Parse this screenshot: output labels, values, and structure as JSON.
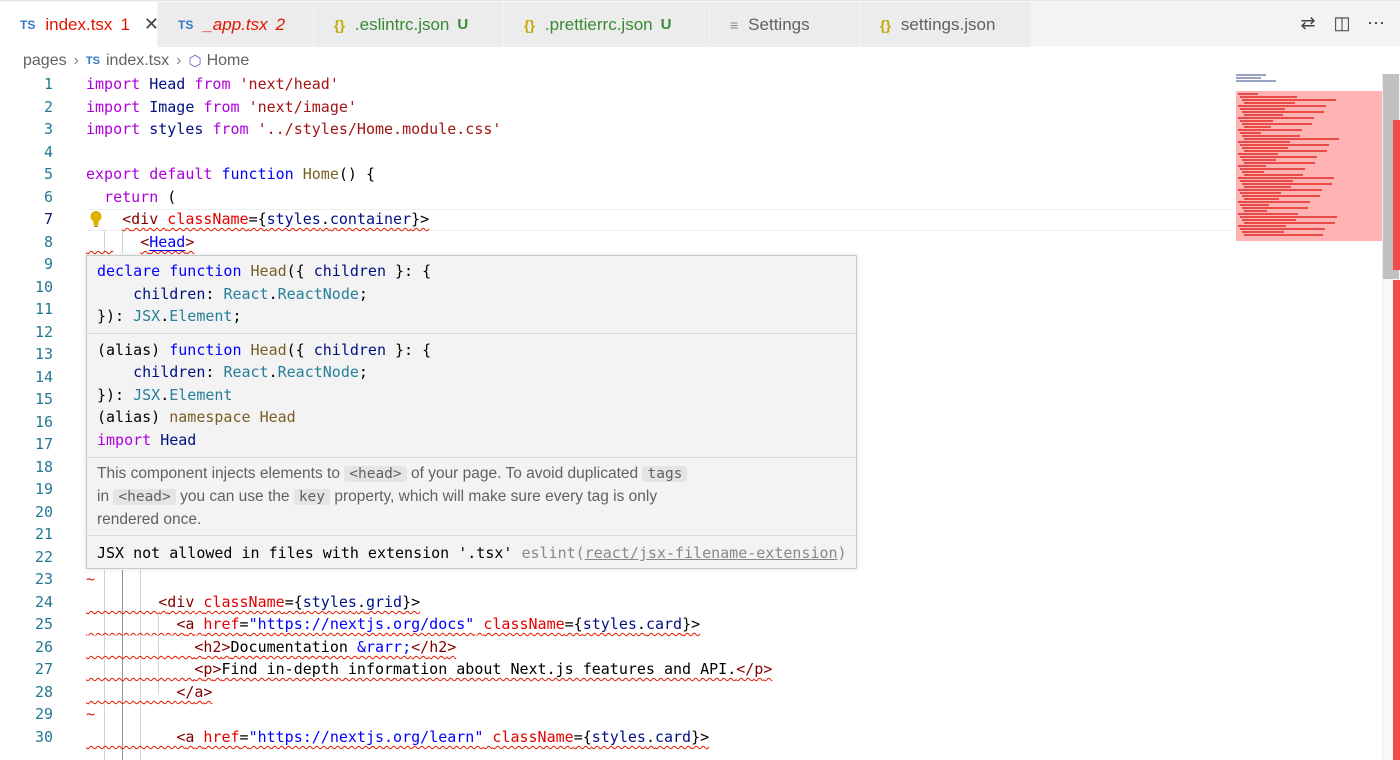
{
  "tabs": [
    {
      "type": "ts",
      "label": "index.tsx",
      "count": "1",
      "active": true,
      "closable": true
    },
    {
      "type": "ts",
      "label": "_app.tsx",
      "count": "2",
      "active": false
    },
    {
      "type": "json",
      "label": ".eslintrc.json",
      "badge": "U",
      "active": false
    },
    {
      "type": "json",
      "label": ".prettierrc.json",
      "badge": "U",
      "active": false
    },
    {
      "type": "settings",
      "label": "Settings",
      "active": false
    },
    {
      "type": "json",
      "label": "settings.json",
      "active": false
    }
  ],
  "tab_icon_ts": "TS",
  "tab_icon_json": "{}",
  "breadcrumb": {
    "folder": "pages",
    "file": "index.tsx",
    "symbol": "Home"
  },
  "line_numbers": [
    "1",
    "2",
    "3",
    "4",
    "5",
    "6",
    "7",
    "8",
    "9",
    "10",
    "11",
    "12",
    "13",
    "14",
    "15",
    "16",
    "17",
    "18",
    "19",
    "20",
    "21",
    "22",
    "23",
    "24",
    "25",
    "26",
    "27",
    "28",
    "29",
    "30"
  ],
  "code": {
    "l1": {
      "kw": "import",
      "id": "Head",
      "from": "from",
      "str": "'next/head'"
    },
    "l2": {
      "kw": "import",
      "id": "Image",
      "from": "from",
      "str": "'next/image'"
    },
    "l3": {
      "kw": "import",
      "id": "styles",
      "from": "from",
      "str": "'../styles/Home.module.css'"
    },
    "l5": {
      "export": "export",
      "default": "default",
      "function": "function",
      "name": "Home",
      "rest": "() {"
    },
    "l6": {
      "ret": "return",
      "rest": " ("
    },
    "l7": {
      "open": "<",
      "tag": "div",
      "attr": "className",
      "eq": "={",
      "obj": "styles",
      "prop": "container",
      "close": "}>"
    },
    "l8": {
      "open": "<",
      "tag": "Head",
      "close": ">"
    },
    "l24": {
      "open": "<",
      "tag": "div",
      "attr": "className",
      "eq": "={",
      "obj": "styles",
      "prop": "grid",
      "close": "}>"
    },
    "l25": {
      "open": "<",
      "tag": "a",
      "attr": "href",
      "eq": "=",
      "str": "\"https://nextjs.org/docs\"",
      "attr2": "className",
      "eq2": "={",
      "obj": "styles",
      "prop": "card",
      "close": "}>"
    },
    "l26": {
      "open": "<",
      "tag": "h2",
      "gt": ">",
      "text": "Documentation ",
      "ent": "&rarr;",
      "end": "</",
      "endtag": "h2",
      "endgt": ">"
    },
    "l27": {
      "open": "<",
      "tag": "p",
      "gt": ">",
      "text": "Find in-depth information about Next.js features and API.",
      "end": "</",
      "endtag": "p",
      "endgt": ">"
    },
    "l28": {
      "end": "</",
      "endtag": "a",
      "endgt": ">"
    },
    "l30": {
      "open": "<",
      "tag": "a",
      "attr": "href",
      "eq": "=",
      "str": "\"https://nextjs.org/learn\"",
      "attr2": "className",
      "eq2": "={",
      "obj": "styles",
      "prop": "card",
      "close": "}>"
    }
  },
  "hover": {
    "decl": {
      "line1": {
        "declare": "declare",
        "function": "function",
        "name": "Head",
        "rest1": "({ ",
        "param": "children",
        "rest2": " }: {"
      },
      "line2": {
        "indent": "    ",
        "param": "children",
        "colon": ": ",
        "ns": "React",
        "dot": ".",
        "type": "ReactNode",
        "semi": ";"
      },
      "line3": {
        "close": "}): ",
        "ns": "JSX",
        "dot": ".",
        "type": "Element",
        "semi": ";"
      }
    },
    "alias": {
      "line1": {
        "alias": "(alias) ",
        "function": "function",
        "name": "Head",
        "rest1": "({ ",
        "param": "children",
        "rest2": " }: {"
      },
      "line2": {
        "indent": "    ",
        "param": "children",
        "colon": ": ",
        "ns": "React",
        "dot": ".",
        "type": "ReactNode",
        "semi": ";"
      },
      "line3": {
        "close": "}): ",
        "ns": "JSX",
        "dot": ".",
        "type": "Element"
      },
      "line4": {
        "alias": "(alias) ",
        "namespace": "namespace",
        "name": "Head"
      },
      "line5": {
        "import": "import",
        "name": "Head"
      }
    },
    "doc": {
      "p1a": "This component injects elements to ",
      "c1": "<head>",
      "p1b": " of your page. To avoid duplicated ",
      "c2": "tags",
      "p2a": "in ",
      "c3": "<head>",
      "p2b": " you can use the ",
      "c4": "key",
      "p2c": " property, which will make sure every tag is only",
      "p3": "rendered once."
    },
    "diagnostic": {
      "message": "JSX not allowed in files with extension '.tsx'",
      "source": " eslint(",
      "rule": "react/jsx-filename-extension",
      "end": ")"
    }
  },
  "colors": {
    "error": "#e51400",
    "keyword": "#af00db",
    "string": "#a31515",
    "type": "#267f99",
    "tab_ts": "#3178c6",
    "untracked": "#388a34"
  },
  "icons": [
    "close-icon",
    "source-control-compare-icon",
    "split-editor-icon",
    "more-actions-icon",
    "lightbulb-icon",
    "symbol-method-icon",
    "chevron-right-icon"
  ]
}
